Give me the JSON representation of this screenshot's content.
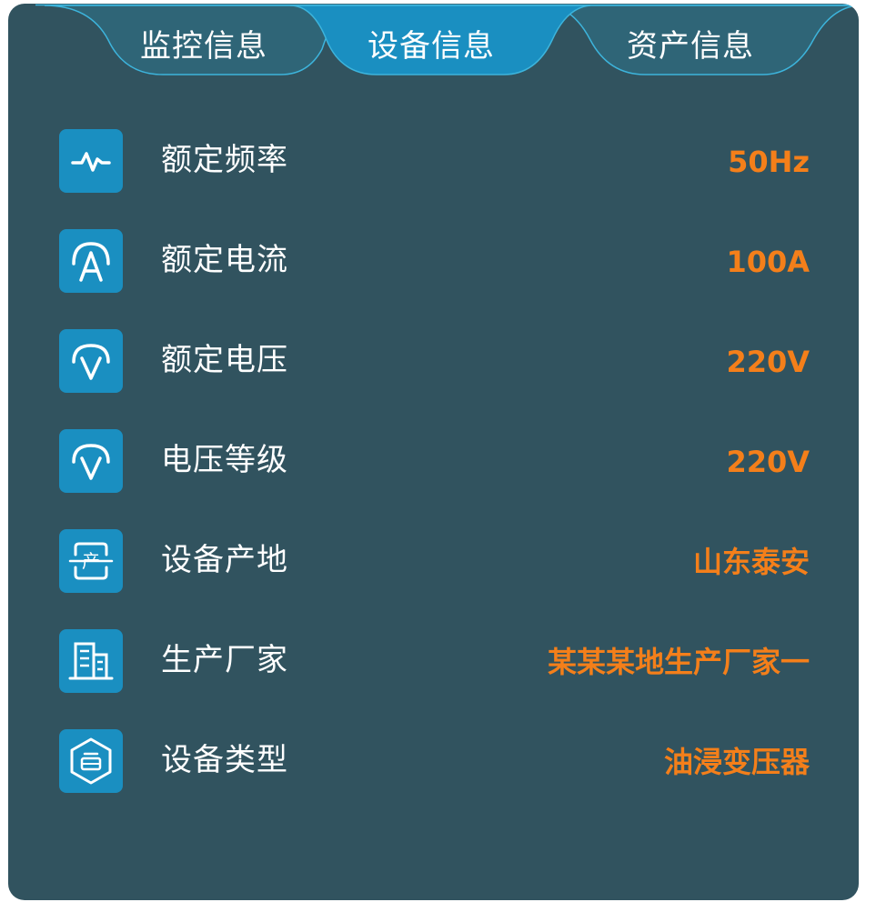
{
  "tabs": [
    {
      "label": "监控信息",
      "active": false
    },
    {
      "label": "设备信息",
      "active": true
    },
    {
      "label": "资产信息",
      "active": false
    }
  ],
  "rows": [
    {
      "icon": "frequency-pulse-icon",
      "label": "额定频率",
      "value": "50Hz"
    },
    {
      "icon": "current-a-icon",
      "label": "额定电流",
      "value": "100A"
    },
    {
      "icon": "voltage-v-icon",
      "label": "额定电压",
      "value": "220V"
    },
    {
      "icon": "voltage-level-icon",
      "label": "电压等级",
      "value": "220V"
    },
    {
      "icon": "origin-scan-icon",
      "label": "设备产地",
      "value": "山东泰安"
    },
    {
      "icon": "factory-building-icon",
      "label": "生产厂家",
      "value": "某某某地生产厂家一"
    },
    {
      "icon": "device-type-hexagon-icon",
      "label": "设备类型",
      "value": "油浸变压器"
    }
  ],
  "colors": {
    "panel_bg": "#31535f",
    "tab_inactive": "#2f6577",
    "tab_active": "#1a8fc1",
    "tab_border": "#3db4dc",
    "icon_bg": "#1a8fc1",
    "value_text": "#f47f1a",
    "label_text": "#ffffff"
  }
}
